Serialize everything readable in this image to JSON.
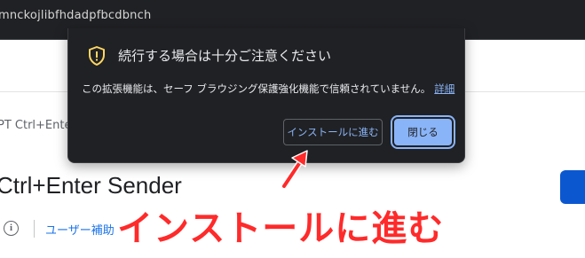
{
  "browser": {
    "address_text": "mnckojlibfhdadpfbcdbnch"
  },
  "page": {
    "breadcrumb": "PT Ctrl+Ente",
    "extension_title": "Ctrl+Enter Sender",
    "info_icon_label": "i",
    "user_link": "ユーザー補助"
  },
  "dialog": {
    "title": "続行する場合は十分ご注意ください",
    "body": "この拡張機能は、セーフ ブラウジング保護強化機能で信頼されていません。",
    "details_link": "詳細",
    "install_button": "インストールに進む",
    "close_button": "閉じる",
    "shield_color": "#fdd663"
  },
  "annotation": {
    "callout": "インストールに進む",
    "color": "#ff2a2a"
  },
  "icons": {
    "shield": "shield-warning-icon",
    "info": "info-icon",
    "arrow": "red-arrow"
  }
}
